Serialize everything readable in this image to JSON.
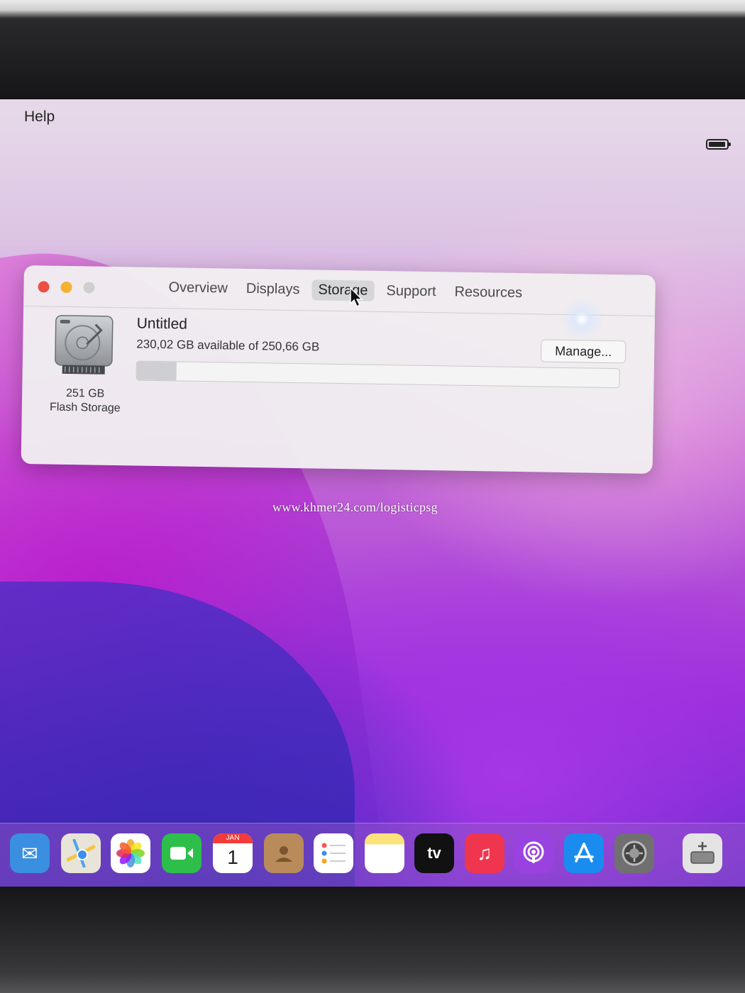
{
  "menubar": {
    "help_label": "Help"
  },
  "window": {
    "tabs": [
      {
        "label": "Overview"
      },
      {
        "label": "Displays"
      },
      {
        "label": "Storage",
        "active": true
      },
      {
        "label": "Support"
      },
      {
        "label": "Resources"
      }
    ],
    "disk": {
      "capacity": "251 GB",
      "type": "Flash Storage",
      "icon": "hard-drive-icon"
    },
    "volume": {
      "name": "Untitled",
      "available_text": "230,02 GB available of 250,66 GB",
      "used_fraction": 0.082
    },
    "manage_label": "Manage..."
  },
  "watermark": "www.khmer24.com/logisticpsg",
  "dock": {
    "calendar_month": "JAN",
    "calendar_day": "1",
    "tv_label": "tv",
    "items": [
      {
        "name": "mail-icon",
        "color": "#3b8fe0"
      },
      {
        "name": "maps-icon",
        "color": "#e8e4d8"
      },
      {
        "name": "photos-icon",
        "color": "#ffffff"
      },
      {
        "name": "facetime-icon",
        "color": "#2dbf4a"
      },
      {
        "name": "calendar-icon",
        "color": "#ffffff"
      },
      {
        "name": "contacts-icon",
        "color": "#b98b5a"
      },
      {
        "name": "reminders-icon",
        "color": "#ffffff"
      },
      {
        "name": "notes-icon",
        "color": "#fbe27a"
      },
      {
        "name": "tv-icon",
        "color": "#111111"
      },
      {
        "name": "music-icon",
        "color": "#f0364e"
      },
      {
        "name": "podcasts-icon",
        "color": "#9a42e0"
      },
      {
        "name": "app-store-icon",
        "color": "#1a8cf0"
      },
      {
        "name": "system-preferences-icon",
        "color": "#707070"
      },
      {
        "name": "disk-utility-icon",
        "color": "#e4e4e4"
      }
    ]
  }
}
